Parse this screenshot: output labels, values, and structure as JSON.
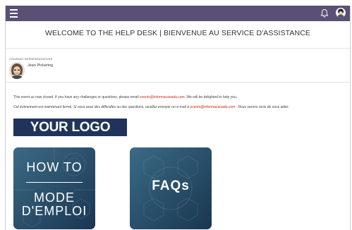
{
  "header": {
    "title": "WELCOME TO THE HELP DESK | BIENVENUE AU SERVICE D'ASSISTANCE"
  },
  "topbar": {
    "menu_icon": "hamburger-menu-icon",
    "notification_icon": "bell-icon",
    "profile_icon": "user-avatar",
    "color": "#5a5076"
  },
  "representatives": {
    "label": "COMPANY REPRESENTATIVES",
    "items": [
      {
        "name": "Jean Pickering"
      }
    ]
  },
  "messages": {
    "en_before": "This event us now closed. If you have any challenges or questions, please email ",
    "en_email": "events@informacanada.com",
    "en_after": ". We will be delighted to help you.",
    "fr_before": "Cet évènement est maintenant fermé. Si vous avez des difficultés ou des questions, veuillez envoyer un e-mail à ",
    "fr_email": "events@informacanada.com",
    "fr_after": " . Nous serons ravis de vous aider."
  },
  "logo": {
    "text": "YOUR LOGO HERE",
    "color": "#20345b"
  },
  "tiles": {
    "howto_line1": "HOW TO",
    "howto_line2": "MODE",
    "howto_line3": "D'EMPLOI",
    "faqs": "FAQs"
  }
}
